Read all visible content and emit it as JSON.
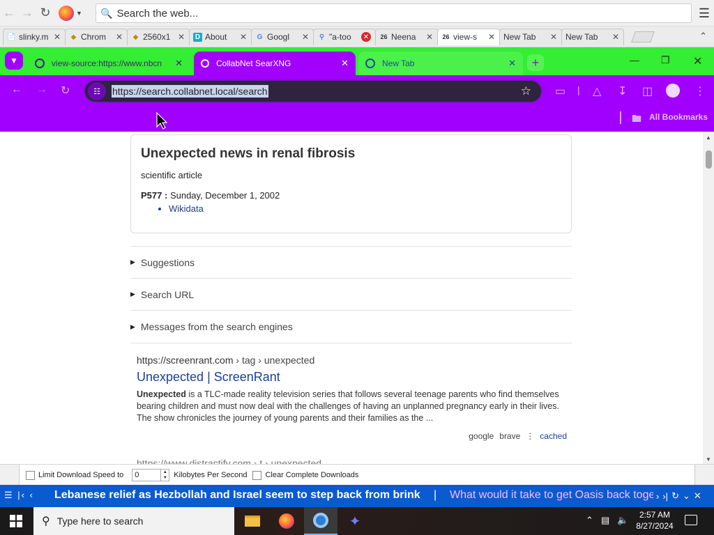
{
  "firefox": {
    "search_placeholder": "Search the web...",
    "tabs": [
      {
        "label": "slinky.m",
        "icon": "doc-icon"
      },
      {
        "label": "Chrom",
        "icon": "puzzle-icon"
      },
      {
        "label": "2560x1",
        "icon": "puzzle-icon"
      },
      {
        "label": "About",
        "icon": "d-logo-icon"
      },
      {
        "label": "Googl",
        "icon": "google-icon"
      },
      {
        "label": "\"a-too",
        "icon": "search-icon"
      },
      {
        "label": "Neena",
        "icon": "26-icon"
      },
      {
        "label": "view-s",
        "icon": "26-icon"
      },
      {
        "label": "New Tab",
        "icon": ""
      },
      {
        "label": "New Tab",
        "icon": ""
      }
    ]
  },
  "chromium": {
    "tabs": [
      {
        "label": "view-source:https://www.nbcn"
      },
      {
        "label": "CollabNet SearXNG"
      },
      {
        "label": "New Tab"
      }
    ],
    "url": "https://search.collabnet.local/search",
    "bookmarks_label": "All Bookmarks"
  },
  "infobox": {
    "title": "Unexpected news in renal fibrosis",
    "subtitle": "scientific article",
    "prop_key": "P577 :",
    "prop_value": "Sunday, December 1, 2002",
    "link": "Wikidata"
  },
  "details": {
    "suggestions": "Suggestions",
    "search_url": "Search URL",
    "messages": "Messages from the search engines"
  },
  "result": {
    "url_host": "https://screenrant.com",
    "url_path": "› tag › unexpected",
    "title": "Unexpected | ScreenRant",
    "snippet_bold": "Unexpected",
    "snippet_rest": " is a TLC-made reality television series that follows several teenage parents who find themselves bearing children and must now deal with the challenges of having an unplanned pregnancy early in their lives. The show chronicles the journey of young parents and their families as the ...",
    "engine1": "google",
    "engine2": "brave",
    "cached": "cached"
  },
  "result2_url": "https://www.distractify.com › t › unexpected",
  "downloads_bar": {
    "limit_label": "Limit Download Speed to",
    "value": "0",
    "unit": "Kilobytes Per Second",
    "clear_label": "Clear Complete Downloads"
  },
  "ticker": {
    "headline1": "Lebanese relief as Hezbollah and Israel seem to step back from brink",
    "separator": "|",
    "headline2": "What would it take to get Oasis back together"
  },
  "taskbar": {
    "search_placeholder": "Type here to search",
    "time": "2:57 AM",
    "date": "8/27/2024"
  },
  "colors": {
    "chrome_tabbar": "#33ee33",
    "chrome_toolbar": "#a100ff",
    "ticker": "#0a5bd0",
    "link": "#1a3fa0"
  }
}
